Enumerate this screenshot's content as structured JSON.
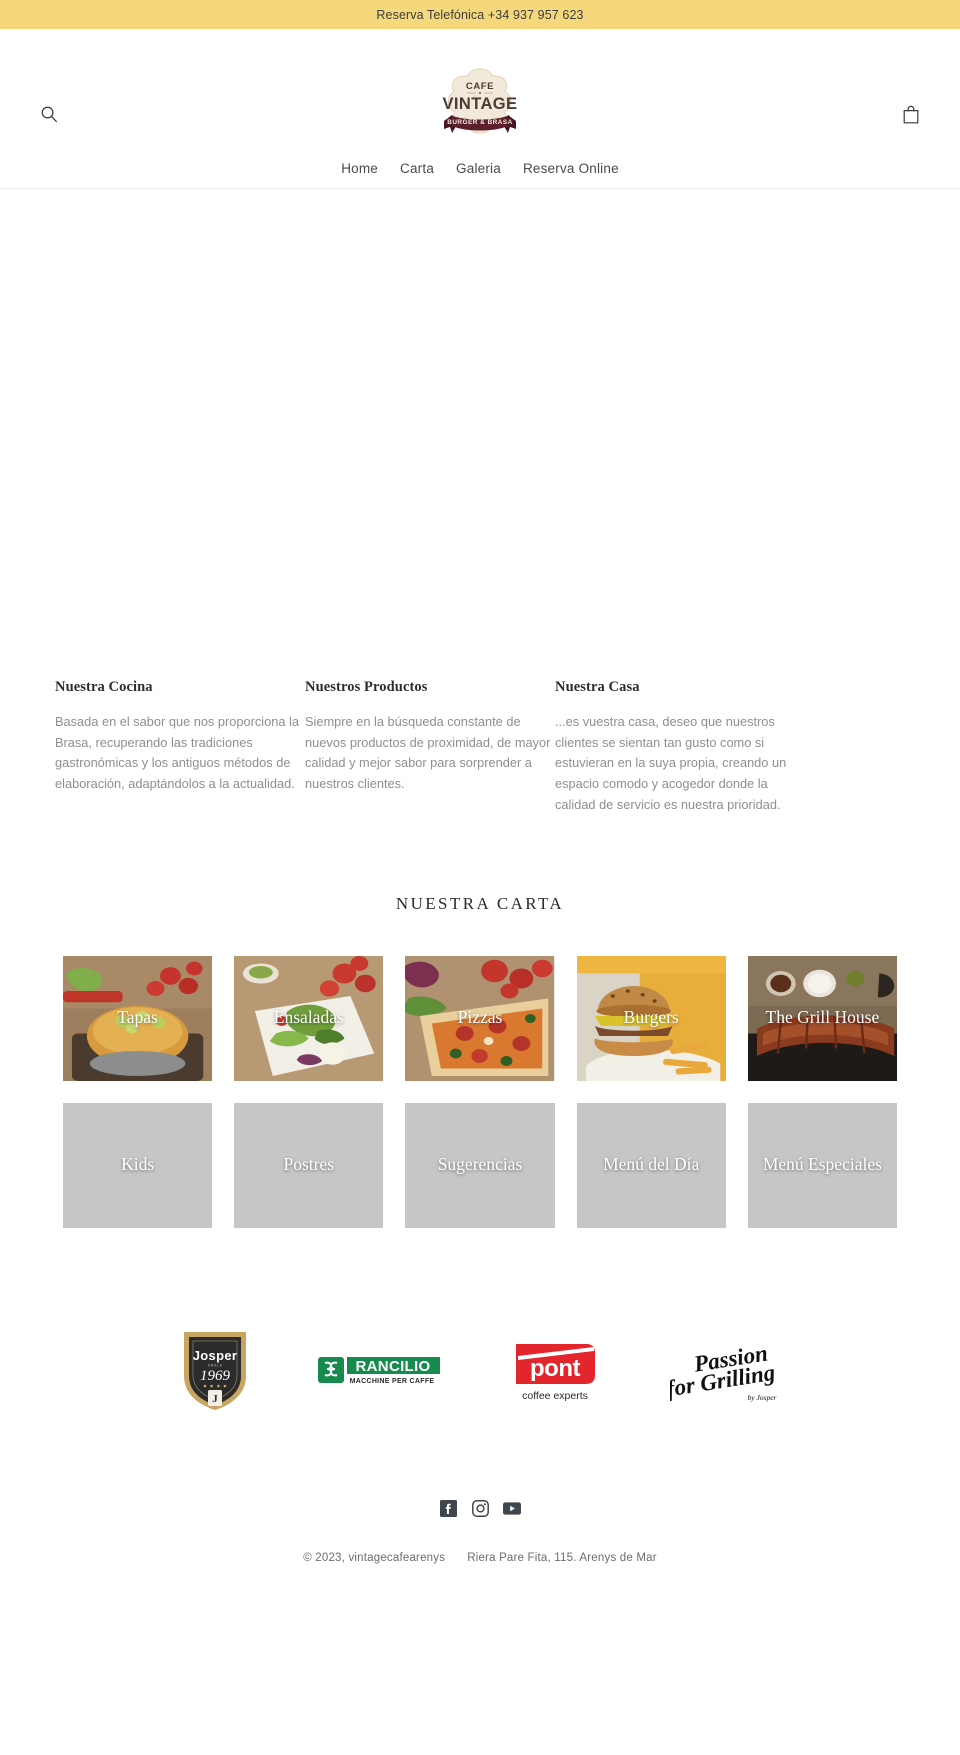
{
  "announcement": {
    "text": "Reserva Telefónica +34 937 957 623",
    "background": "#f6d87c"
  },
  "header": {
    "search_icon": "search-icon",
    "cart_icon": "shopping-bag-icon",
    "logo": {
      "top_text": "CAFE",
      "main_text": "VINTAGE",
      "ribbon_text": "BURGER & BRASA",
      "cream": "#f3e9db",
      "maroon": "#5c1f2b",
      "dark": "#4a3b33"
    },
    "nav": [
      {
        "label": "Home"
      },
      {
        "label": "Carta"
      },
      {
        "label": "Galeria"
      },
      {
        "label": "Reserva Online"
      }
    ]
  },
  "intro": {
    "columns": [
      {
        "heading": "Nuestra Cocina",
        "body": "Basada en el sabor que nos proporciona la Brasa, recuperando las tradiciones gastronómicas y los antiguos métodos de elaboración, adaptándolos a la actualidad."
      },
      {
        "heading": "Nuestros Productos",
        "body": "Siempre en la búsqueda constante de nuevos productos de proximidad, de mayor calidad y mejor sabor para sorprender a nuestros clientes."
      },
      {
        "heading": "Nuestra Casa",
        "body": "...es vuestra casa, deseo que nuestros clientes se sientan tan gusto como si estuvieran en la suya propia, creando un espacio comodo y acogedor donde la calidad de servicio es nuestra prioridad."
      }
    ]
  },
  "carta": {
    "title": "NUESTRA CARTA",
    "cards": [
      {
        "label": "Tapas",
        "has_image": true,
        "art": "tapas"
      },
      {
        "label": "Ensaladas",
        "has_image": true,
        "art": "ensaladas"
      },
      {
        "label": "Pizzas",
        "has_image": true,
        "art": "pizzas"
      },
      {
        "label": "Burgers",
        "has_image": true,
        "art": "burgers"
      },
      {
        "label": "The Grill House",
        "has_image": true,
        "art": "grill"
      },
      {
        "label": "Kids",
        "has_image": false,
        "art": ""
      },
      {
        "label": "Postres",
        "has_image": false,
        "art": ""
      },
      {
        "label": "Sugerencias",
        "has_image": false,
        "art": ""
      },
      {
        "label": "Menú del Día",
        "has_image": false,
        "art": ""
      },
      {
        "label": "Menú Especiales",
        "has_image": false,
        "art": ""
      }
    ],
    "placeholder_color": "#c6c6c6"
  },
  "partners": [
    {
      "name": "josper-logo",
      "title": "Josper",
      "year": "1969",
      "colors": {
        "shield": "#2b2b2b",
        "gold": "#c8a560"
      }
    },
    {
      "name": "rancilio-logo",
      "title": "RANCILIO",
      "subtitle": "MACCHINE PER CAFFE",
      "colors": {
        "green": "#178b4e"
      }
    },
    {
      "name": "pont-logo",
      "title": "pont",
      "subtitle": "coffee experts",
      "colors": {
        "red": "#e3262b"
      }
    },
    {
      "name": "passion-for-grilling-logo",
      "title": "Passion for Grilling",
      "subtitle": "by Josper"
    }
  ],
  "footer": {
    "social": [
      {
        "name": "facebook-icon"
      },
      {
        "name": "instagram-icon"
      },
      {
        "name": "youtube-icon"
      }
    ],
    "copyright": "© 2023, vintagecafearenys",
    "address": "Riera Pare Fita, 115. Arenys de Mar"
  }
}
